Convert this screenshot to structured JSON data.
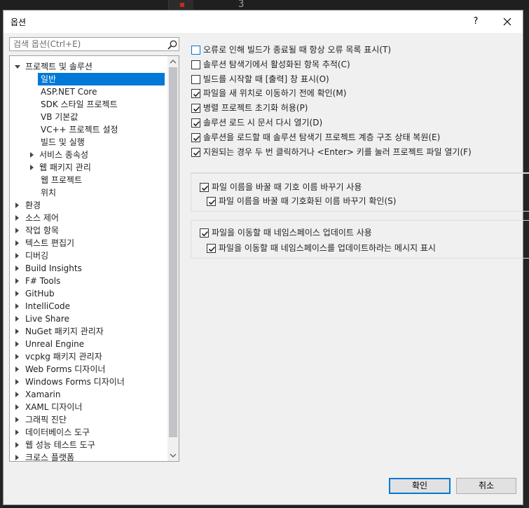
{
  "background": {
    "line_number": "3"
  },
  "dialog": {
    "title": "옵션",
    "help_label": "?",
    "search": {
      "placeholder": "검색 옵션(Ctrl+E)"
    },
    "tree": [
      {
        "label": "프로젝트 및 솔루션",
        "level": 0,
        "arrow": "down",
        "selected": false
      },
      {
        "label": "일반",
        "level": 2,
        "arrow": "",
        "selected": true
      },
      {
        "label": "ASP.NET Core",
        "level": 2,
        "arrow": "",
        "selected": false
      },
      {
        "label": "SDK 스타일 프로젝트",
        "level": 2,
        "arrow": "",
        "selected": false
      },
      {
        "label": "VB 기본값",
        "level": 2,
        "arrow": "",
        "selected": false
      },
      {
        "label": "VC++ 프로젝트 설정",
        "level": 2,
        "arrow": "",
        "selected": false
      },
      {
        "label": "빌드 및 실행",
        "level": 2,
        "arrow": "",
        "selected": false
      },
      {
        "label": "서비스 종속성",
        "level": 1,
        "arrow": "right",
        "selected": false
      },
      {
        "label": "웹 패키지 관리",
        "level": 1,
        "arrow": "right",
        "selected": false
      },
      {
        "label": "웹 프로젝트",
        "level": 2,
        "arrow": "",
        "selected": false
      },
      {
        "label": "위치",
        "level": 2,
        "arrow": "",
        "selected": false
      },
      {
        "label": "환경",
        "level": 0,
        "arrow": "right",
        "selected": false
      },
      {
        "label": "소스 제어",
        "level": 0,
        "arrow": "right",
        "selected": false
      },
      {
        "label": "작업 항목",
        "level": 0,
        "arrow": "right",
        "selected": false
      },
      {
        "label": "텍스트 편집기",
        "level": 0,
        "arrow": "right",
        "selected": false
      },
      {
        "label": "디버깅",
        "level": 0,
        "arrow": "right",
        "selected": false
      },
      {
        "label": "Build Insights",
        "level": 0,
        "arrow": "right",
        "selected": false
      },
      {
        "label": "F# Tools",
        "level": 0,
        "arrow": "right",
        "selected": false
      },
      {
        "label": "GitHub",
        "level": 0,
        "arrow": "right",
        "selected": false
      },
      {
        "label": "IntelliCode",
        "level": 0,
        "arrow": "right",
        "selected": false
      },
      {
        "label": "Live Share",
        "level": 0,
        "arrow": "right",
        "selected": false
      },
      {
        "label": "NuGet 패키지 관리자",
        "level": 0,
        "arrow": "right",
        "selected": false
      },
      {
        "label": "Unreal Engine",
        "level": 0,
        "arrow": "right",
        "selected": false
      },
      {
        "label": "vcpkg 패키지 관리자",
        "level": 0,
        "arrow": "right",
        "selected": false
      },
      {
        "label": "Web Forms 디자이너",
        "level": 0,
        "arrow": "right",
        "selected": false
      },
      {
        "label": "Windows Forms 디자이너",
        "level": 0,
        "arrow": "right",
        "selected": false
      },
      {
        "label": "Xamarin",
        "level": 0,
        "arrow": "right",
        "selected": false
      },
      {
        "label": "XAML 디자이너",
        "level": 0,
        "arrow": "right",
        "selected": false
      },
      {
        "label": "그래픽 진단",
        "level": 0,
        "arrow": "right",
        "selected": false
      },
      {
        "label": "데이터베이스 도구",
        "level": 0,
        "arrow": "right",
        "selected": false
      },
      {
        "label": "웹 성능 테스트 도구",
        "level": 0,
        "arrow": "right",
        "selected": false
      },
      {
        "label": "크로스 플랫폼",
        "level": 0,
        "arrow": "right",
        "selected": false
      }
    ],
    "options": [
      {
        "label": "오류로 인해 빌드가 종료될 때 항상 오류 목록 표시(T)",
        "checked": false
      },
      {
        "label": "솔루션 탐색기에서 활성화된 항목 추적(C)",
        "checked": false
      },
      {
        "label": "빌드를 시작할 때 [출력] 창 표시(O)",
        "checked": false
      },
      {
        "label": "파일을 새 위치로 이동하기 전에 확인(M)",
        "checked": true
      },
      {
        "label": "병렬 프로젝트 초기화 허용(P)",
        "checked": true
      },
      {
        "label": "솔루션 로드 시 문서 다시 열기(D)",
        "checked": true
      },
      {
        "label": "솔루션을 로드할 때 솔루션 탐색기 프로젝트 계층 구조 상태 복원(E)",
        "checked": true
      },
      {
        "label": "지원되는 경우 두 번 클릭하거나 <Enter> 키를 눌러 프로젝트 파일 열기(F)",
        "checked": true
      }
    ],
    "rename_group": {
      "main": {
        "label": "파일 이름을 바꿀 때 기호 이름 바꾸기 사용",
        "checked": true
      },
      "sub": {
        "label": "파일 이름을 바꿀 때 기호화된 이름 바꾸기 확인(S)",
        "checked": true
      }
    },
    "namespace_group": {
      "main": {
        "label": "파일을 이동할 때 네임스페이스 업데이트 사용",
        "checked": true
      },
      "sub": {
        "label": "파일을 이동할 때 네임스페이스를 업데이트하라는 메시지 표시",
        "checked": true
      }
    },
    "ok_label": "확인",
    "cancel_label": "취소"
  }
}
